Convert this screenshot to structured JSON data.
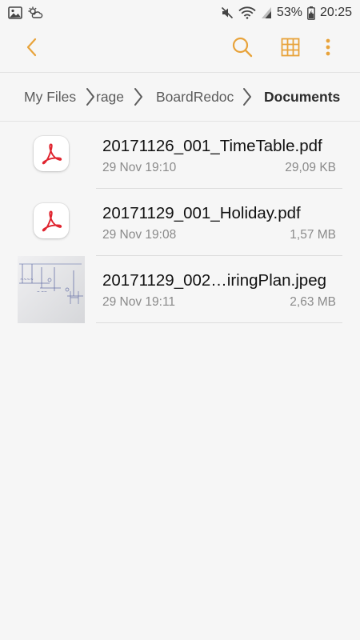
{
  "status_bar": {
    "battery_percent": "53%",
    "time": "20:25",
    "icons": [
      "gallery-icon",
      "weather-icon",
      "mute-icon",
      "wifi-icon",
      "signal-icon",
      "battery-icon"
    ]
  },
  "toolbar": {
    "back_icon": "chevron-left-icon",
    "search_icon": "search-icon",
    "grid_icon": "grid-view-icon",
    "more_icon": "more-vert-icon",
    "accent_color": "#e8a33b"
  },
  "breadcrumb": {
    "items": [
      {
        "label": "My Files"
      },
      {
        "label": "rage"
      },
      {
        "label": "BoardRedoc"
      },
      {
        "label": "Documents"
      }
    ]
  },
  "files": [
    {
      "name": "20171126_001_TimeTable.pdf",
      "date": "29 Nov 19:10",
      "size": "29,09 KB",
      "type": "pdf"
    },
    {
      "name": "20171129_001_Holiday.pdf",
      "date": "29 Nov 19:08",
      "size": "1,57 MB",
      "type": "pdf"
    },
    {
      "name": "20171129_002…iringPlan.jpeg",
      "date": "29 Nov 19:11",
      "size": "2,63 MB",
      "type": "image"
    }
  ]
}
